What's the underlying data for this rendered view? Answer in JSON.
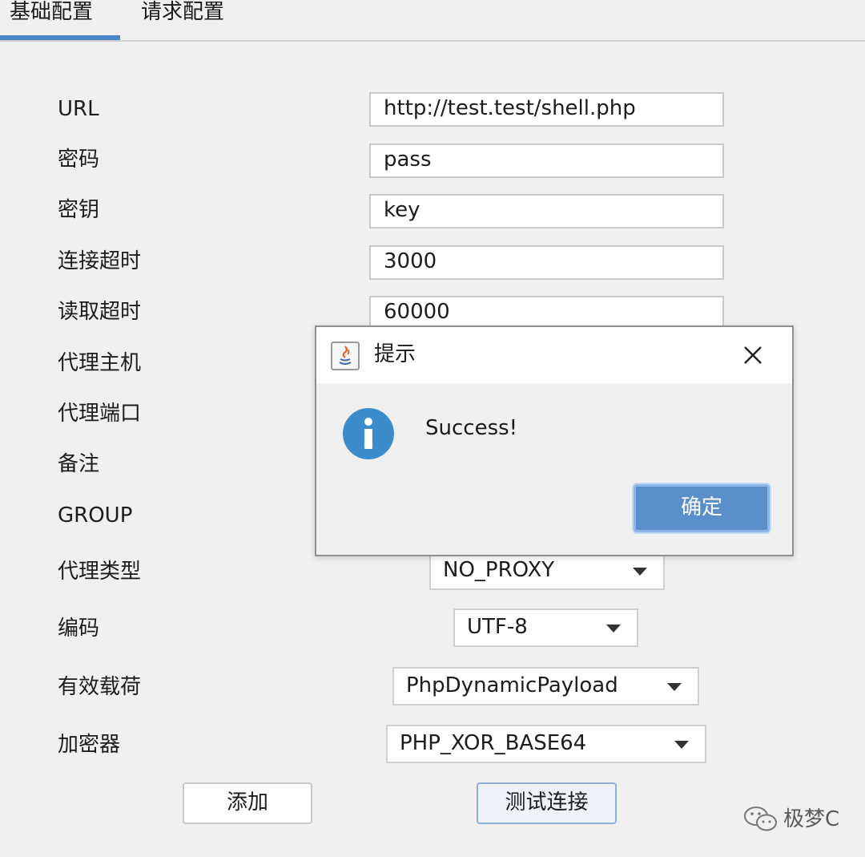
{
  "tabs": [
    {
      "label": "基础配置",
      "active": true
    },
    {
      "label": "请求配置",
      "active": false
    }
  ],
  "form": {
    "url_label": "URL",
    "url_value": "http://test.test/shell.php",
    "password_label": "密码",
    "password_value": "pass",
    "key_label": "密钥",
    "key_value": "key",
    "connect_timeout_label": "连接超时",
    "connect_timeout_value": "3000",
    "read_timeout_label": "读取超时",
    "read_timeout_value": "60000",
    "proxy_host_label": "代理主机",
    "proxy_port_label": "代理端口",
    "note_label": "备注",
    "group_label": "GROUP",
    "proxy_type_label": "代理类型",
    "proxy_type_value": "NO_PROXY",
    "encoding_label": "编码",
    "encoding_value": "UTF-8",
    "payload_label": "有效载荷",
    "payload_value": "PhpDynamicPayload",
    "encryptor_label": "加密器",
    "encryptor_value": "PHP_XOR_BASE64"
  },
  "buttons": {
    "add": "添加",
    "test_connection": "测试连接"
  },
  "dialog": {
    "title": "提示",
    "message": "Success!",
    "ok": "确定",
    "icon": "info-icon"
  },
  "watermark": {
    "text": "极梦C",
    "icon": "wechat-icon"
  },
  "colors": {
    "accent": "#4a86c8",
    "ok_button": "#5b8fcb",
    "info_icon": "#3c8ccb"
  }
}
